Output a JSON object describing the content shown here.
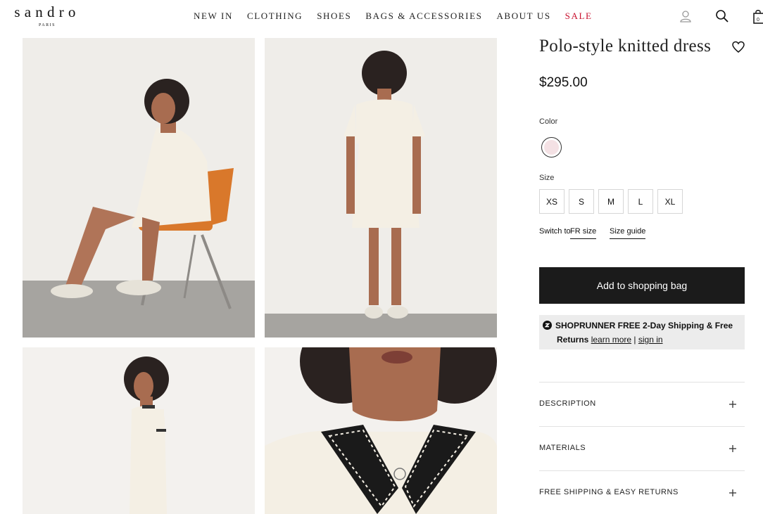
{
  "header": {
    "logo": "sandro",
    "logo_sub": "PARIS",
    "nav": [
      "NEW IN",
      "CLOTHING",
      "SHOES",
      "BAGS & ACCESSORIES",
      "ABOUT US",
      "SALE"
    ],
    "cart_count": "0",
    "icons": [
      "account-icon",
      "search-icon",
      "shopping-bag-icon"
    ]
  },
  "gallery": {
    "images": [
      "model-seated-side-view",
      "model-back-view",
      "model-side-profile",
      "collar-close-up"
    ]
  },
  "product": {
    "title": "Polo-style knitted dress",
    "price": "$295.00",
    "color_label": "Color",
    "swatch_color": "#f4e1e4",
    "size_label": "Size",
    "sizes": [
      "XS",
      "S",
      "M",
      "L",
      "XL"
    ],
    "switch_prefix": "Switch to ",
    "switch_link": "FR size",
    "size_guide": "Size guide",
    "add_to_bag": "Add to shopping bag"
  },
  "shoprunner": {
    "line1": "SHOPRUNNER FREE 2-Day Shipping & Free",
    "line2_bold": "Returns",
    "learn_more": "learn more",
    "separator": "|",
    "sign_in": "sign in"
  },
  "accordion": [
    "DESCRIPTION",
    "MATERIALS",
    "FREE SHIPPING & EASY RETURNS"
  ],
  "colors": {
    "sale": "#c8102e",
    "button": "#1b1b1b",
    "shoprunner_bg": "#ececec"
  }
}
